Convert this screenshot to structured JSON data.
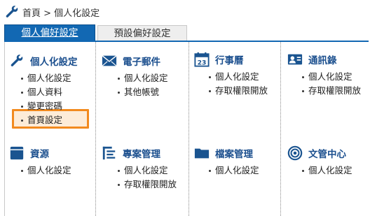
{
  "breadcrumb": {
    "text": "首頁 > 個人化設定"
  },
  "tabs": [
    {
      "label": "個人偏好設定",
      "active": true
    },
    {
      "label": "預設偏好設定",
      "active": false
    }
  ],
  "sections": [
    {
      "title": "個人化設定",
      "icon": "wrench-icon",
      "items": [
        "個人化設定",
        "個人資料",
        "變更密碼",
        "首頁設定"
      ]
    },
    {
      "title": "電子郵件",
      "icon": "mail-icon",
      "items": [
        "個人化設定",
        "其他帳號"
      ]
    },
    {
      "title": "行事曆",
      "icon": "calendar-icon",
      "icon_text": "23",
      "items": [
        "個人化設定",
        "存取權限開放"
      ]
    },
    {
      "title": "通訊錄",
      "icon": "contact-card-icon",
      "items": [
        "個人化設定",
        "存取權限開放"
      ]
    },
    {
      "title": "資源",
      "icon": "box-icon",
      "items": [
        "個人化設定"
      ]
    },
    {
      "title": "專案管理",
      "icon": "project-list-icon",
      "items": [
        "個人化設定",
        "存取權限開放"
      ]
    },
    {
      "title": "檔案管理",
      "icon": "folder-icon",
      "items": [
        "個人化設定"
      ]
    },
    {
      "title": "文管中心",
      "icon": "target-icon",
      "items": [
        "個人化設定"
      ]
    }
  ],
  "highlight": {
    "item": "首頁設定",
    "color": "#f28a1e"
  },
  "colors": {
    "accent": "#1268b3",
    "title": "#1b4f8e"
  }
}
